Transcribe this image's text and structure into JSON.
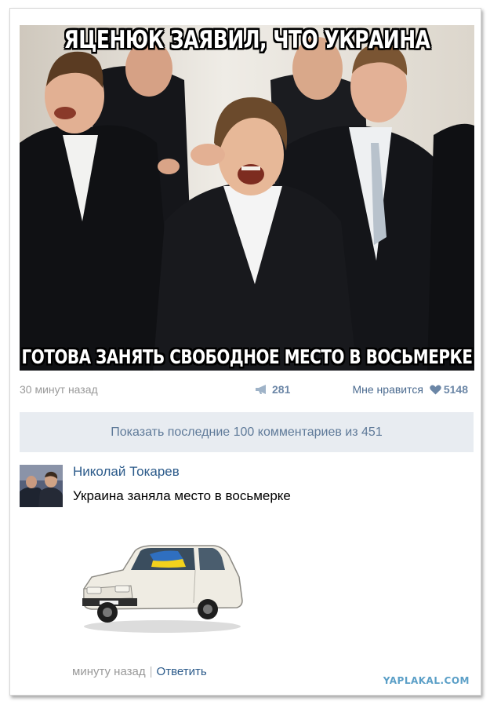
{
  "post": {
    "meme_top_text": "ЯЦЕНЮК ЗАЯВИЛ, ЧТО УКРАИНА",
    "meme_bottom_text": "ГОТОВА ЗАНЯТЬ СВОБОДНОЕ МЕСТО В ВОСЬМЕРКЕ",
    "timestamp": "30 минут назад",
    "reposts": "281",
    "like_label": "Мне нравится",
    "likes": "5148"
  },
  "comments_bar": {
    "label": "Показать последние 100 комментариев из 451"
  },
  "comment": {
    "author": "Николай Токарев",
    "text": "Украина заняла место в восьмерке",
    "time": "минуту назад",
    "separator": "|",
    "reply_label": "Ответить"
  },
  "watermark": "YAPLAKAL.COM",
  "colors": {
    "link": "#2b5a8a",
    "muted": "#999999",
    "bar_bg": "#e8ecf1",
    "bar_text": "#5f7a99",
    "watermark": "#5b9fc7"
  },
  "icons": {
    "repost": "megaphone-icon",
    "like": "heart-icon"
  }
}
